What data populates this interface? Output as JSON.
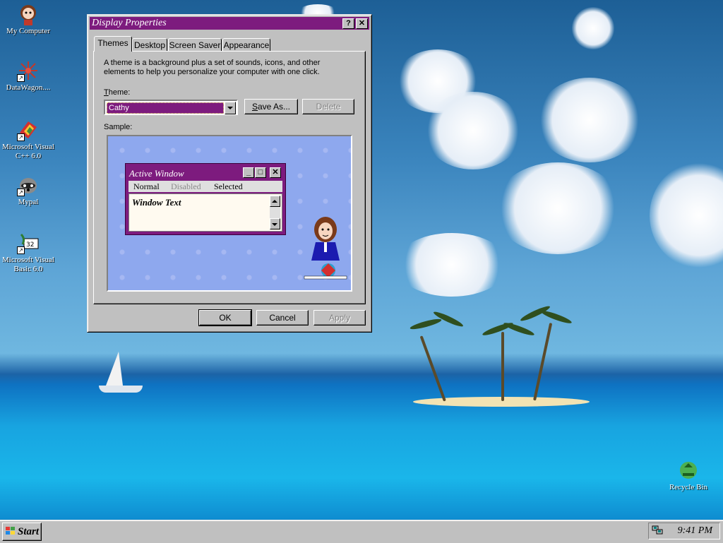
{
  "desktop": {
    "icons": [
      {
        "label": "My Computer"
      },
      {
        "label": "DataWagon...."
      },
      {
        "label": "Microsoft Visual C++ 6.0"
      },
      {
        "label": "Mypal"
      },
      {
        "label": "Microsoft Visual Basic 6.0"
      },
      {
        "label": "Recycle Bin"
      }
    ]
  },
  "dialog": {
    "title": "Display Properties",
    "help_button": "?",
    "close_button": "✕",
    "tabs": [
      {
        "label": "Themes",
        "active": true
      },
      {
        "label": "Desktop",
        "active": false
      },
      {
        "label": "Screen Saver",
        "active": false
      },
      {
        "label": "Appearance",
        "active": false
      }
    ],
    "description": "A theme is a background plus a set of sounds, icons, and other elements to help you personalize your computer with one click.",
    "theme_label_prefix": "",
    "theme_label_hotkey": "T",
    "theme_label_rest": "heme:",
    "theme_value": "Cathy",
    "save_as_hotkey": "S",
    "save_as_rest": "ave As...",
    "delete_label": "Delete",
    "sample_label": "Sample:",
    "sample": {
      "window_title": "Active Window",
      "menu_normal": "Normal",
      "menu_disabled": "Disabled",
      "menu_selected": "Selected",
      "window_text": "Window Text"
    },
    "ok_label": "OK",
    "cancel_label": "Cancel",
    "apply_label": "Apply"
  },
  "taskbar": {
    "start_label": "Start",
    "clock": "9:41 PM"
  },
  "colors": {
    "title_bar": "#7d1b7e",
    "face": "#c0c0c0"
  }
}
